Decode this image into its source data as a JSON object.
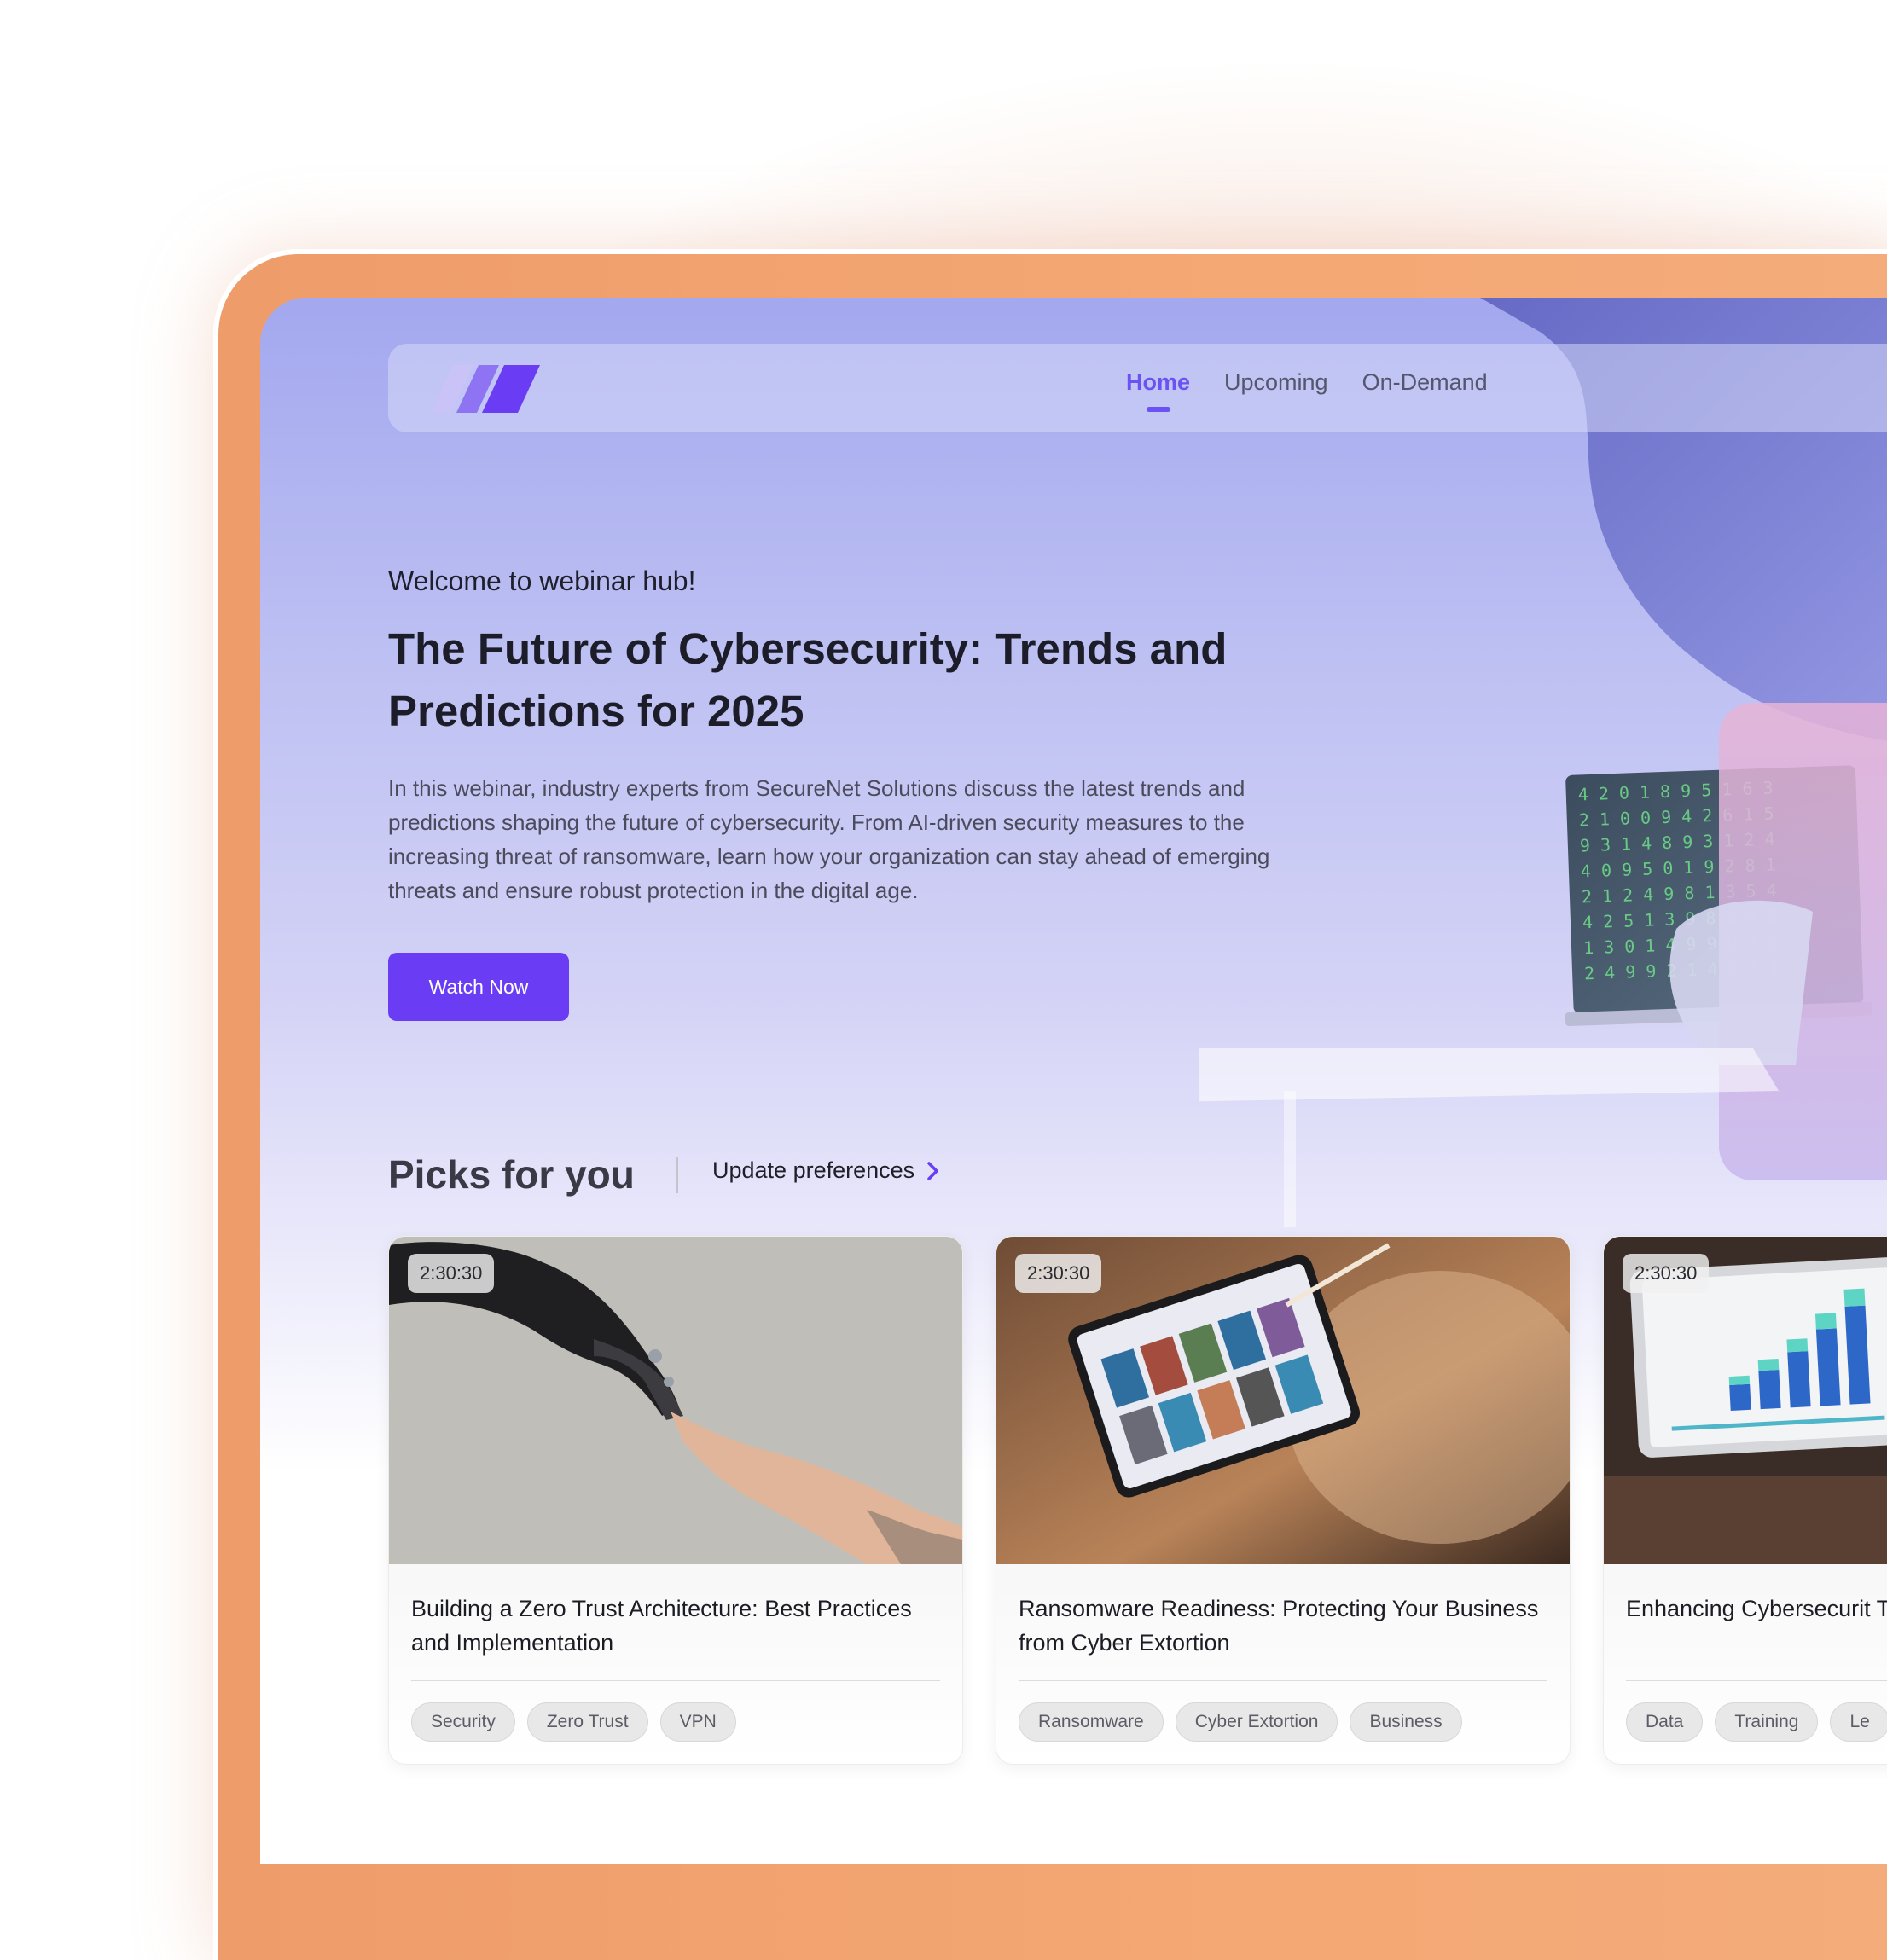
{
  "nav": {
    "items": [
      {
        "label": "Home",
        "active": true
      },
      {
        "label": "Upcoming",
        "active": false
      },
      {
        "label": "On-Demand",
        "active": false
      }
    ]
  },
  "hero": {
    "welcome": "Welcome to webinar hub!",
    "title": "The Future of Cybersecurity: Trends and Predictions for 2025",
    "description": "In this webinar, industry experts from SecureNet Solutions discuss the latest trends and predictions shaping the future of cybersecurity. From AI-driven security measures to the increasing threat of ransomware, learn how your organization can stay ahead of emerging threats and ensure robust protection in the digital age.",
    "cta_label": "Watch Now"
  },
  "picks": {
    "title": "Picks for you",
    "update_label": "Update preferences",
    "cards": [
      {
        "duration": "2:30:30",
        "title": "Building a Zero Trust Architecture: Best Practices and Implementation",
        "tags": [
          "Security",
          "Zero Trust",
          "VPN"
        ]
      },
      {
        "duration": "2:30:30",
        "title": "Ransomware Readiness: Protecting Your Business from Cyber Extortion",
        "tags": [
          "Ransomware",
          "Cyber Extortion",
          "Business"
        ]
      },
      {
        "duration": "2:30:30",
        "title": "Enhancing Cybersecurit Training",
        "tags": [
          "Data",
          "Training",
          "Le"
        ]
      }
    ]
  },
  "colors": {
    "accent": "#6a3df5",
    "device_frame": "#f0a06c"
  }
}
